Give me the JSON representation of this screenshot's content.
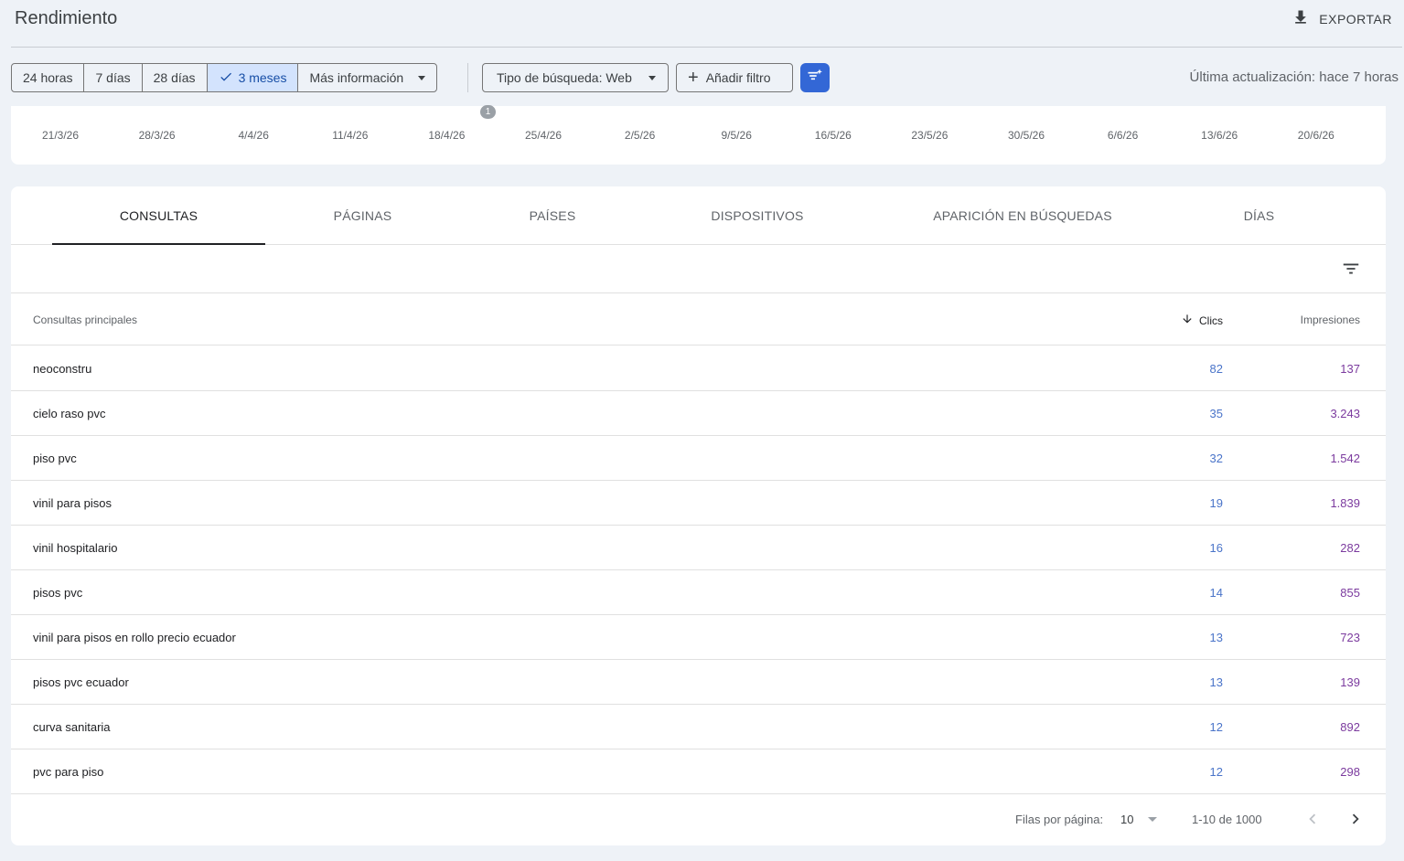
{
  "header": {
    "title": "Rendimiento",
    "export_label": "EXPORTAR"
  },
  "filters": {
    "ranges": [
      {
        "label": "24 horas",
        "selected": false
      },
      {
        "label": "7 días",
        "selected": false
      },
      {
        "label": "28 días",
        "selected": false
      },
      {
        "label": "3 meses",
        "selected": true
      },
      {
        "label": "Más información",
        "selected": false
      }
    ],
    "search_type": "Tipo de búsqueda: Web",
    "add_filter": "Añadir filtro",
    "last_update": "Última actualización: hace 7 horas"
  },
  "chart": {
    "x_ticks": [
      "21/3/26",
      "28/3/26",
      "4/4/26",
      "11/4/26",
      "18/4/26",
      "25/4/26",
      "2/5/26",
      "9/5/26",
      "16/5/26",
      "23/5/26",
      "30/5/26",
      "6/6/26",
      "13/6/26",
      "20/6/26"
    ],
    "annotation": "1"
  },
  "tabs": [
    "CONSULTAS",
    "PÁGINAS",
    "PAÍSES",
    "DISPOSITIVOS",
    "APARICIÓN EN BÚSQUEDAS",
    "DÍAS"
  ],
  "table": {
    "headers": {
      "query": "Consultas principales",
      "clicks": "Clics",
      "impressions": "Impresiones"
    },
    "rows": [
      {
        "query": "neoconstru",
        "clicks": "82",
        "impressions": "137"
      },
      {
        "query": "cielo raso pvc",
        "clicks": "35",
        "impressions": "3.243"
      },
      {
        "query": "piso pvc",
        "clicks": "32",
        "impressions": "1.542"
      },
      {
        "query": "vinil para pisos",
        "clicks": "19",
        "impressions": "1.839"
      },
      {
        "query": "vinil hospitalario",
        "clicks": "16",
        "impressions": "282"
      },
      {
        "query": "pisos pvc",
        "clicks": "14",
        "impressions": "855"
      },
      {
        "query": "vinil para pisos en rollo precio ecuador",
        "clicks": "13",
        "impressions": "723"
      },
      {
        "query": "pisos pvc ecuador",
        "clicks": "13",
        "impressions": "139"
      },
      {
        "query": "curva sanitaria",
        "clicks": "12",
        "impressions": "892"
      },
      {
        "query": "pvc para piso",
        "clicks": "12",
        "impressions": "298"
      }
    ]
  },
  "pagination": {
    "rows_per_page_label": "Filas por página:",
    "rows_per_page": "10",
    "range": "1-10 de 1000"
  },
  "colors": {
    "clicks": "#4a74c9",
    "impressions": "#7b3a9e",
    "accent": "#3367d6",
    "selected_range": "#d3e3fd"
  }
}
